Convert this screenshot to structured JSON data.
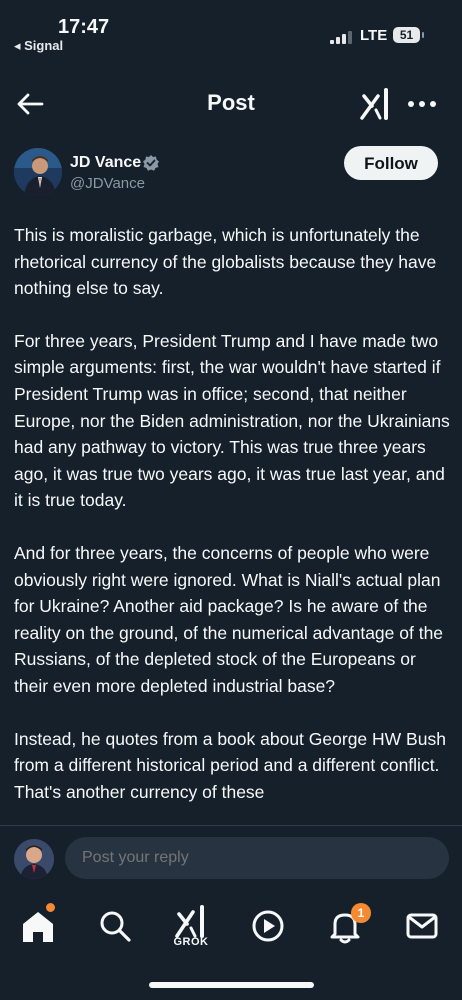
{
  "status_bar": {
    "time": "17:47",
    "back_app": "◂ Signal",
    "network": "LTE",
    "battery": "51"
  },
  "nav": {
    "title": "Post"
  },
  "author": {
    "name": "JD Vance",
    "handle": "@JDVance",
    "follow_label": "Follow"
  },
  "post": {
    "paragraphs": [
      "This is moralistic garbage, which is unfortunately the rhetorical currency of the globalists because they have nothing else to say.",
      "For three years, President Trump and I have made two simple arguments: first, the war wouldn't have started if President Trump was in office; second, that neither Europe, nor the Biden administration, nor the Ukrainians had any pathway to victory. This was true three years ago, it was true two years ago, it was true last year, and it is true today.",
      "And for three years, the concerns of people who were obviously right were ignored. What is Niall's actual plan for Ukraine? Another aid package? Is he aware of the reality on the ground, of the numerical advantage of the Russians, of the depleted stock of the Europeans or their even more depleted industrial base?",
      "Instead, he quotes from a book about George HW Bush from a different historical period and a different conflict. That's another currency of these"
    ]
  },
  "reply": {
    "placeholder": "Post your reply"
  },
  "bottom_nav": {
    "grok_label": "GROK",
    "notifications_count": "1",
    "accent": "#f58a33"
  },
  "colors": {
    "background": "#15202b",
    "text": "#f7f9f9",
    "muted": "#8b98a5",
    "verified": "#8b98a5"
  }
}
